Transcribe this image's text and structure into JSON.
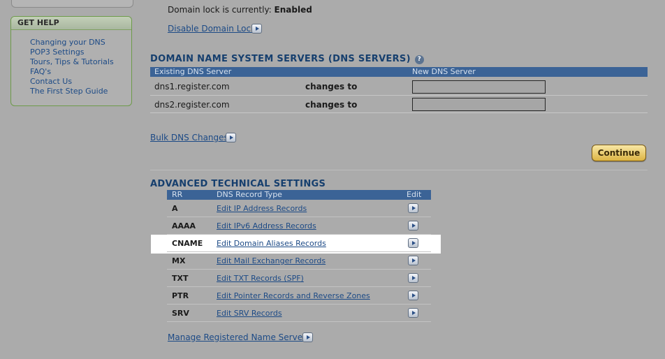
{
  "sidebar": {
    "help_title": "GET HELP",
    "help_links": [
      "Changing your DNS",
      "POP3 Settings",
      "Tours, Tips & Tutorials",
      "FAQ's",
      "Contact Us",
      "The First Step Guide"
    ]
  },
  "domain_lock": {
    "status_label": "Domain lock is currently:",
    "status_value": "Enabled",
    "disable_link": "Disable Domain Lock"
  },
  "dns": {
    "heading": "DOMAIN NAME SYSTEM SERVERS (DNS SERVERS)",
    "help_icon": "?",
    "col_existing": "Existing DNS Server",
    "col_new": "New DNS Server",
    "rows": [
      {
        "server": "dns1.register.com",
        "changes": "changes to",
        "value": ""
      },
      {
        "server": "dns2.register.com",
        "changes": "changes to",
        "value": ""
      }
    ],
    "bulk_link": "Bulk DNS Changes",
    "continue_label": "Continue"
  },
  "advanced": {
    "heading": "ADVANCED TECHNICAL SETTINGS",
    "col_rr": "RR",
    "col_type": "DNS Record Type",
    "col_edit": "Edit",
    "rows": [
      {
        "rr": "A",
        "link": "Edit IP Address Records"
      },
      {
        "rr": "AAAA",
        "link": "Edit IPv6 Address Records"
      },
      {
        "rr": "CNAME",
        "link": "Edit Domain Aliases Records"
      },
      {
        "rr": "MX",
        "link": "Edit Mail Exchanger Records"
      },
      {
        "rr": "TXT",
        "link": "Edit TXT Records (SPF)"
      },
      {
        "rr": "PTR",
        "link": "Edit Pointer Records and Reverse Zones"
      },
      {
        "rr": "SRV",
        "link": "Edit SRV Records"
      }
    ],
    "manage_link": "Manage Registered Name Servers"
  },
  "icons": {
    "arrow": "arrow-right-icon",
    "help": "help-icon"
  },
  "colors": {
    "background": "#ababab",
    "table_header": "#3b6396",
    "link": "#1c4a86",
    "heading": "#163f6e",
    "continue": "#dcb444",
    "help_border": "#6d9a4a"
  }
}
